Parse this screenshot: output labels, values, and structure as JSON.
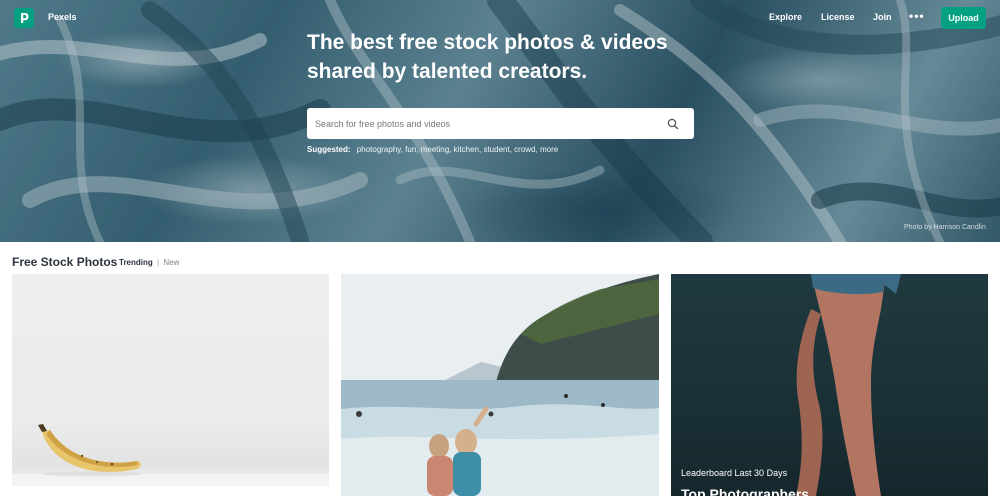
{
  "nav": {
    "brand": "Pexels",
    "links": [
      "Explore",
      "License",
      "Join"
    ],
    "more": "•••",
    "upload": "Upload"
  },
  "hero": {
    "headline_line1": "The best free stock photos & videos",
    "headline_line2": "shared by talented creators.",
    "search_placeholder": "Search for free photos and videos",
    "suggested_label": "Suggested:",
    "suggestions": [
      "photography,",
      "fun,",
      "meeting,",
      "kitchen,",
      "student,",
      "crowd,",
      "more"
    ],
    "photo_credit": "Photo by Harrison Candlin"
  },
  "section": {
    "title": "Free Stock Photos",
    "filter_trending": "Trending",
    "filter_separator": "|",
    "filter_new": "New"
  },
  "cards": {
    "card3_caption": "Leaderboard Last 30 Days",
    "card3_title": "Top Photographers"
  },
  "colors": {
    "accent": "#05a081",
    "text_dark": "#2c343e"
  },
  "icons": {
    "logo": "pexels-logo-icon",
    "search": "search-icon",
    "more": "more-dots-icon"
  }
}
